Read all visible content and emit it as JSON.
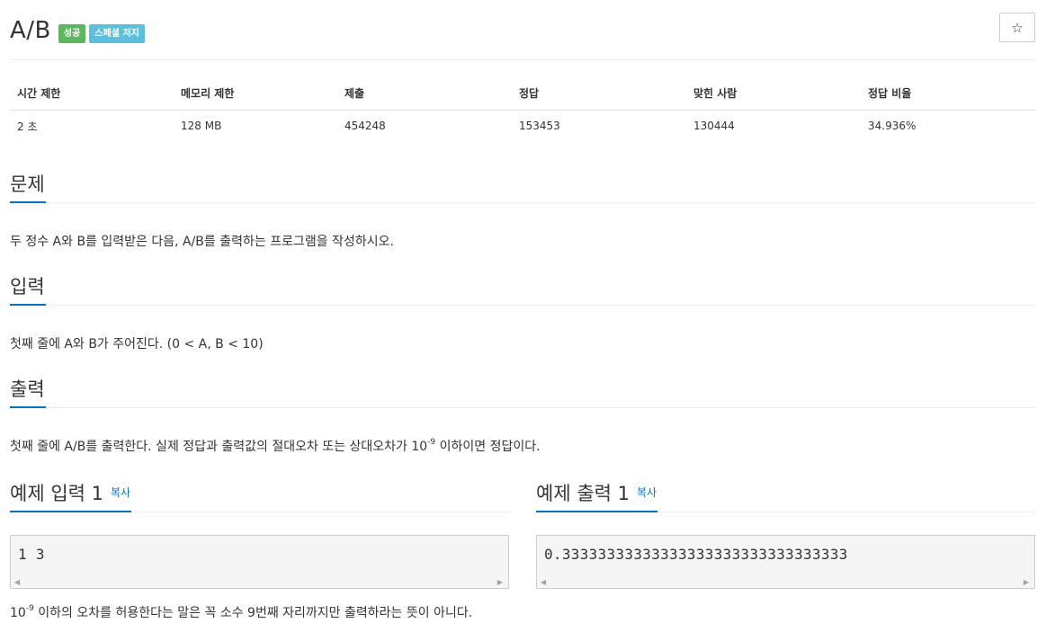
{
  "header": {
    "title": "A/B",
    "labels": {
      "success": "성공",
      "special_judge": "스페셜 저지"
    },
    "star_glyph": "☆",
    "colors": {
      "success": "#5cb85c",
      "info": "#5bc0de",
      "accent": "#0076c0"
    }
  },
  "info_table": {
    "headers": [
      "시간 제한",
      "메모리 제한",
      "제출",
      "정답",
      "맞힌 사람",
      "정답 비율"
    ],
    "values": [
      "2 초",
      "128 MB",
      "454248",
      "153453",
      "130444",
      "34.936%"
    ]
  },
  "sections": {
    "problem": {
      "title": "문제",
      "text": "두 정수 A와 B를 입력받은 다음, A/B를 출력하는 프로그램을 작성하시오."
    },
    "input": {
      "title": "입력",
      "text": "첫째 줄에 A와 B가 주어진다. (0 < A, B < 10)"
    },
    "output": {
      "title": "출력",
      "text_before": "첫째 줄에 A/B를 출력한다. 실제 정답과 출력값의 절대오차 또는 상대오차가 10",
      "exponent": "-9",
      "text_after": " 이하이면 정답이다."
    }
  },
  "samples": {
    "input": {
      "title": "예제 입력 1",
      "copy_label": "복사",
      "content": "1 3"
    },
    "output": {
      "title": "예제 출력 1",
      "copy_label": "복사",
      "content": "0.33333333333333333333333333333333"
    }
  },
  "note": {
    "base": "10",
    "exponent": "-9",
    "text": " 이하의 오차를 허용한다는 말은 꼭 소수 9번째 자리까지만 출력하라는 뜻이 아니다."
  }
}
